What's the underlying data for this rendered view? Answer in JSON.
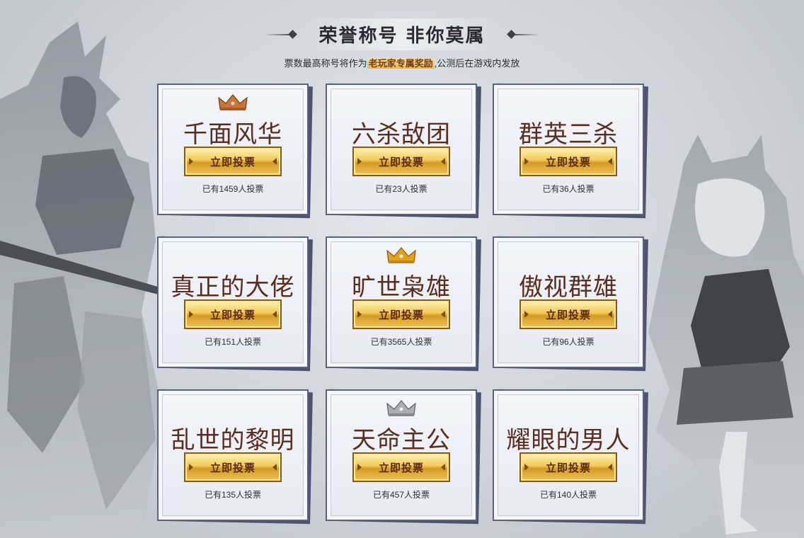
{
  "header": {
    "title": "荣誉称号 非你莫属",
    "subtitle_prefix": "票数最高称号将作为",
    "subtitle_highlight": "老玩家专属奖励",
    "subtitle_suffix": ",公测后在游戏内发放"
  },
  "colors": {
    "title_text": "#5a2e1e",
    "button_gold": "#f3c95a",
    "card_border": "#5b6280",
    "crown_bronze": "#c8743a",
    "crown_gold": "#e2a21e",
    "crown_silver": "#a9adb5"
  },
  "cards": [
    {
      "title": "千面风华",
      "button": "立即投票",
      "votes": "已有1459人投票",
      "crown": "bronze"
    },
    {
      "title": "六杀敌团",
      "button": "立即投票",
      "votes": "已有23人投票",
      "crown": ""
    },
    {
      "title": "群英三杀",
      "button": "立即投票",
      "votes": "已有36人投票",
      "crown": ""
    },
    {
      "title": "真正的大佬",
      "button": "立即投票",
      "votes": "已有151人投票",
      "crown": ""
    },
    {
      "title": "旷世枭雄",
      "button": "立即投票",
      "votes": "已有3565人投票",
      "crown": "gold"
    },
    {
      "title": "傲视群雄",
      "button": "立即投票",
      "votes": "已有96人投票",
      "crown": ""
    },
    {
      "title": "乱世的黎明",
      "button": "立即投票",
      "votes": "已有135人投票",
      "crown": ""
    },
    {
      "title": "天命主公",
      "button": "立即投票",
      "votes": "已有457人投票",
      "crown": "silver"
    },
    {
      "title": "耀眼的男人",
      "button": "立即投票",
      "votes": "已有140人投票",
      "crown": ""
    }
  ]
}
